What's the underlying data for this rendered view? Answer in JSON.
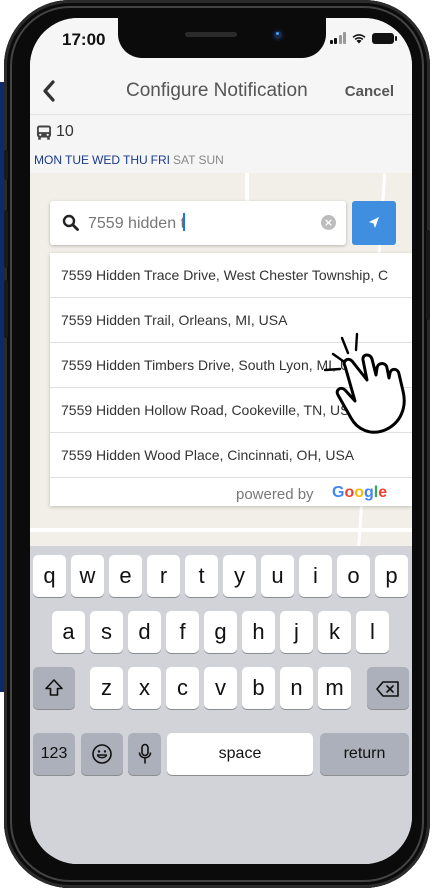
{
  "status_bar": {
    "time": "17:00"
  },
  "nav": {
    "back_icon": "chevron-left-icon",
    "title": "Configure Notification",
    "cancel_label": "Cancel"
  },
  "route": {
    "icon": "bus-icon",
    "number": "10",
    "days_active": [
      "MON",
      "TUE",
      "WED",
      "THU",
      "FRI"
    ],
    "days_inactive": [
      "SAT",
      "SUN"
    ]
  },
  "search": {
    "value": "7559 hidden t",
    "icon": "search-icon",
    "clear_icon": "clear-icon",
    "locate_icon": "location-arrow-icon"
  },
  "results": [
    "7559 Hidden Trace Drive, West Chester Township, C",
    "7559 Hidden Trail, Orleans, MI, USA",
    "7559 Hidden Timbers Drive, South Lyon, MI, U",
    "7559 Hidden Hollow Road, Cookeville, TN, USA",
    "7559 Hidden Wood Place, Cincinnati, OH, USA"
  ],
  "powered_by": {
    "label": "powered by",
    "brand": "Google"
  },
  "keyboard": {
    "row1": [
      "q",
      "w",
      "e",
      "r",
      "t",
      "y",
      "u",
      "i",
      "o",
      "p"
    ],
    "row2": [
      "a",
      "s",
      "d",
      "f",
      "g",
      "h",
      "j",
      "k",
      "l"
    ],
    "row3": [
      "z",
      "x",
      "c",
      "v",
      "b",
      "n",
      "m"
    ],
    "numbers_label": "123",
    "space_label": "space",
    "return_label": "return"
  },
  "colors": {
    "accent": "#3f8ee0",
    "days_active": "#1a3a8a",
    "side_panel": "#0d2a6b"
  }
}
